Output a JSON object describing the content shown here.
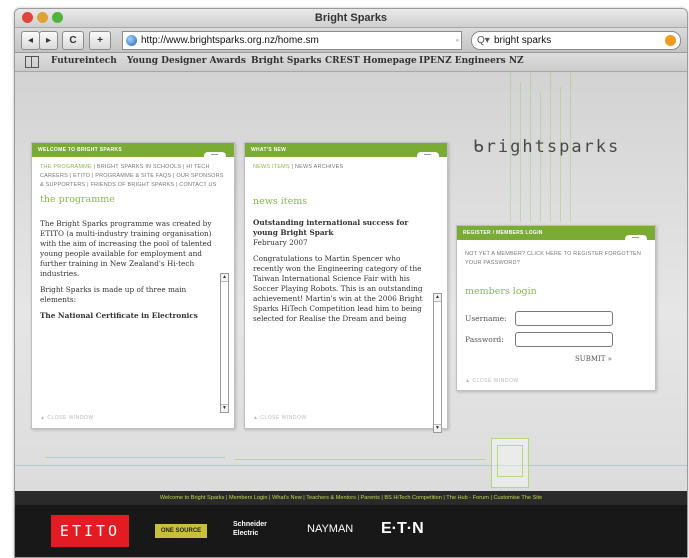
{
  "window": {
    "title": "Bright Sparks"
  },
  "toolbar": {
    "back": "◂",
    "forward": "▸",
    "reload": "C",
    "add": "+",
    "url": "http://www.brightsparks.org.nz/home.sm",
    "search_value": "bright sparks",
    "search_glyph": "Q▾"
  },
  "bookmarks": [
    "Futureintech",
    "Young Designer Awards",
    "Bright Sparks",
    "CREST Homepage",
    "IPENZ Engineers NZ"
  ],
  "logo": "ᑲrightsparks",
  "panel1": {
    "header": "WELCOME TO BRIGHT SPARKS",
    "subnav_active": "THE PROGRAMME",
    "subnav_rest": " | BRIGHT SPARKS IN SCHOOLS | HI TECH CAREERS | ETITO | PROGRAMME & SITE FAQS | OUR SPONSORS & SUPPORTERS | FRIENDS OF BRIGHT SPARKS | CONTACT US",
    "title": "the programme",
    "para1": "The Bright Sparks programme was created by ETITO (a multi-industry training organisation) with the aim of increasing the pool of talented young people available for employment and further training in New Zealand's Hi-tech industries.",
    "para2": "Bright Sparks is made up of three main elements:",
    "para3": "The National Certificate in Electronics",
    "close": "▲ CLOSE WINDOW"
  },
  "panel2": {
    "header": "WHAT'S NEW",
    "subnav_active": "NEWS ITEMS",
    "subnav_rest": " | NEWS ARCHIVES",
    "title": "news items",
    "headline": "Outstanding international success for young Bright Spark",
    "date": "February 2007",
    "body": "Congratulations to Martin Spencer who recently won the Engineering category of the Taiwan International Science Fair with his Soccer Playing Robots. This is an outstanding achievement! Martin's win at the 2006 Bright Sparks HiTech Competition lead him to being selected for Realise the Dream and being",
    "close": "▲ CLOSE WINDOW"
  },
  "panel3": {
    "header": "REGISTER / MEMBERS LOGIN",
    "note": "NOT YET A MEMBER? CLICK HERE TO REGISTER FORGOTTEN YOUR PASSWORD?",
    "title": "members login",
    "username_label": "Username:",
    "password_label": "Password:",
    "submit": "SUBMIT »",
    "close": "▲ CLOSE WINDOW"
  },
  "footer": {
    "links": "Welcome to Bright Sparks | Members Login | What's New | Teachers & Mentors | Parents | BS HiTech Competition | The Hub - Forum | Customise The Site",
    "sponsors": [
      "ETITO",
      "ONE SOURCE",
      "Schneider Electric",
      "NAYMAN",
      "E·T·N"
    ]
  },
  "colors": {
    "accent": "#7aab34",
    "link_green": "#8ab84a",
    "etito_red": "#e31c24"
  }
}
